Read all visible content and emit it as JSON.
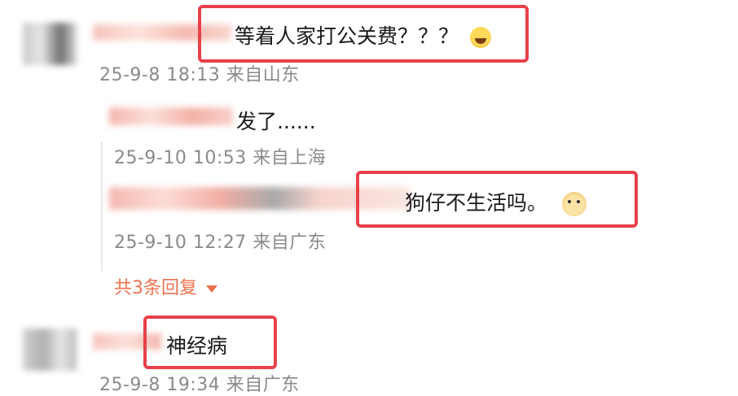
{
  "comments": [
    {
      "text": "等着人家打公关费？？？",
      "emoji": "laughing-emoji",
      "meta": "25-9-8 18:13 来自山东"
    },
    {
      "text": "神经病",
      "meta": "25-9-8 19:34 来自广东"
    }
  ],
  "replies": [
    {
      "text": "发了......",
      "meta": "25-9-10 10:53 来自上海"
    },
    {
      "text": "狗仔不生活吗。",
      "emoji": "doge-emoji",
      "meta": "25-9-10 12:27 来自广东"
    }
  ],
  "reply_count_label": "共3条回复",
  "colors": {
    "highlight": "#e8414a",
    "link": "#eb7350",
    "meta": "#8a8a8a"
  }
}
